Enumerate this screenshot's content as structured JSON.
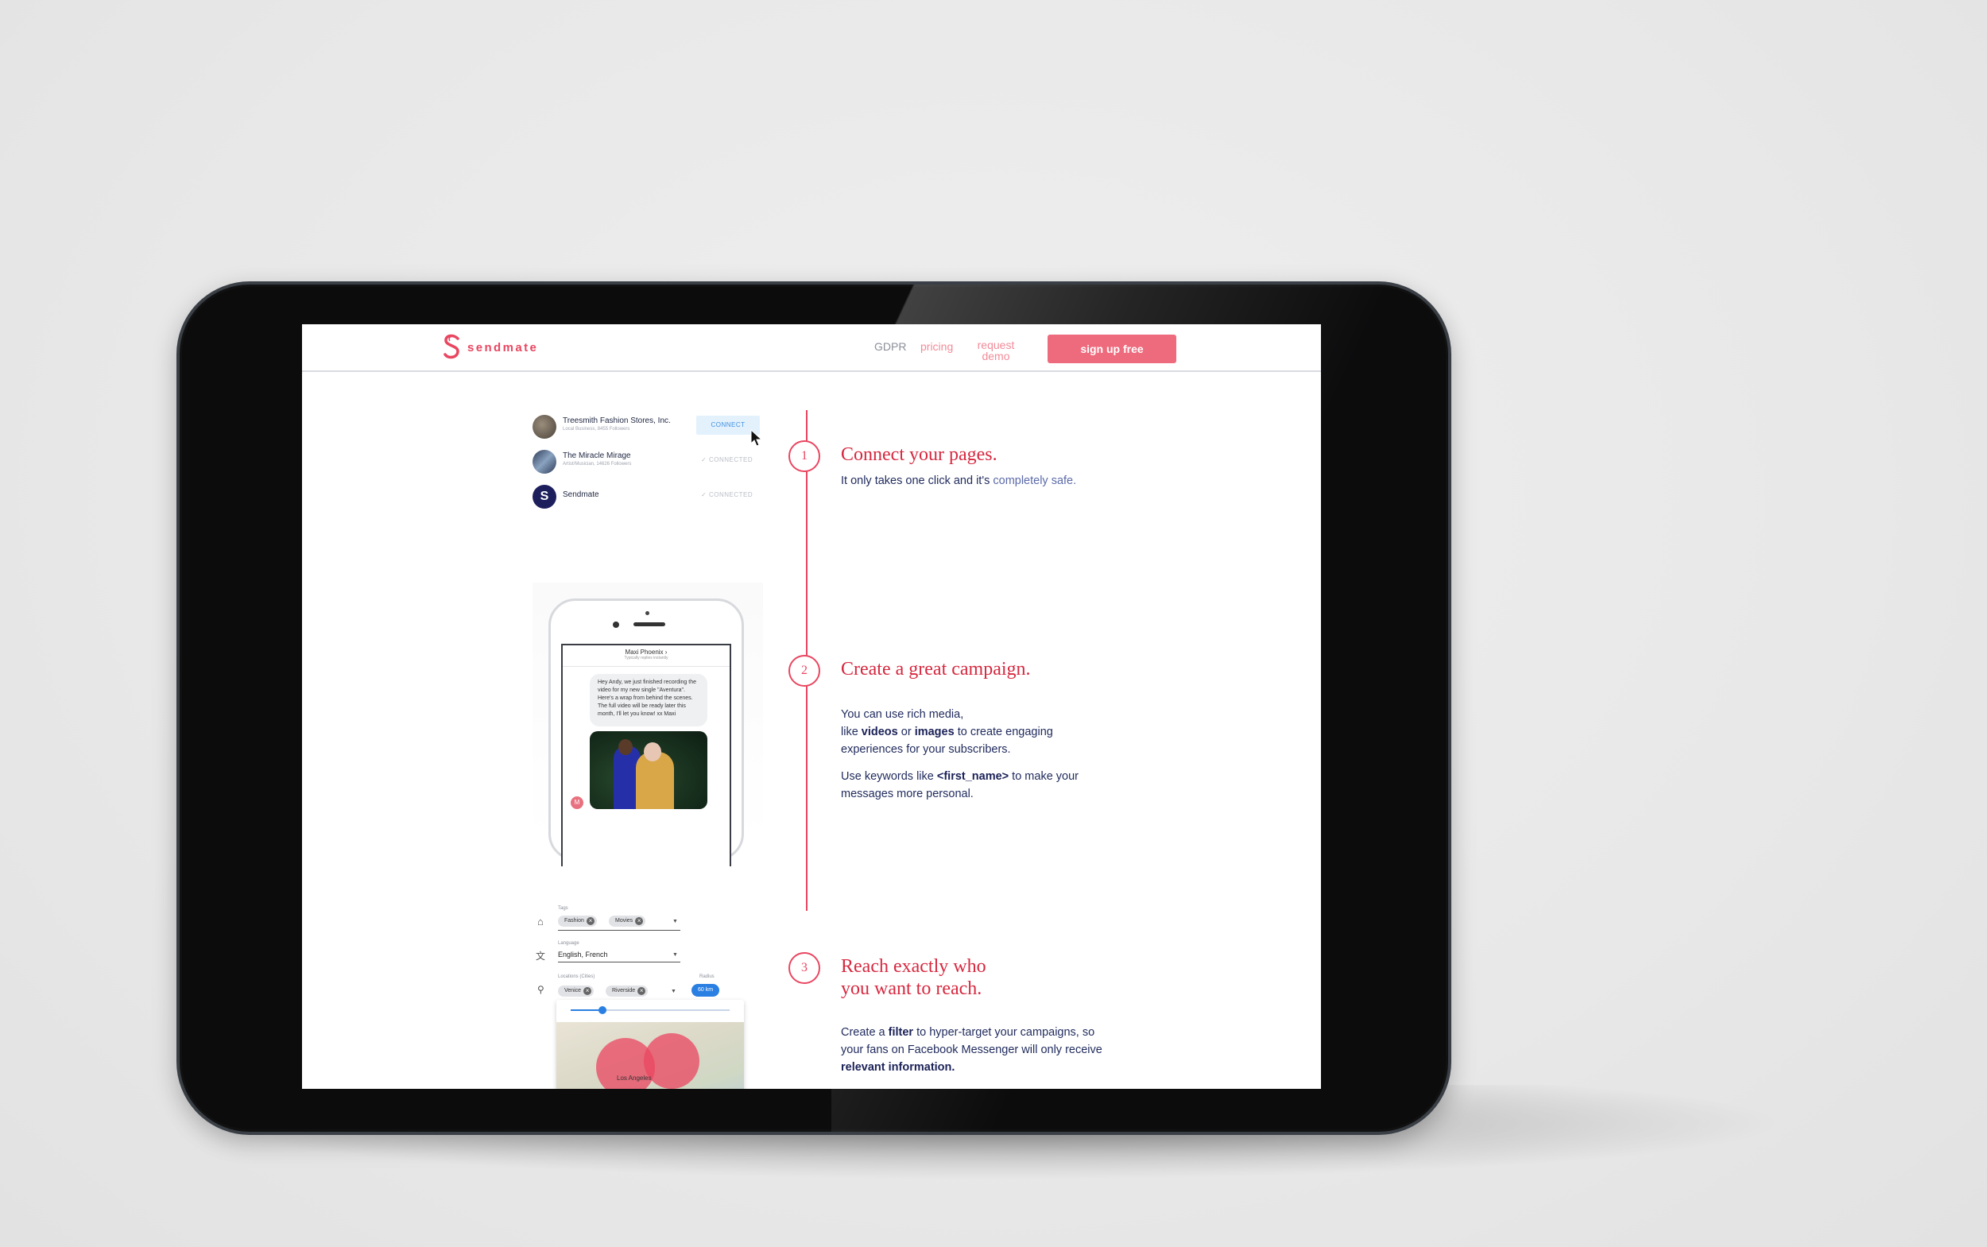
{
  "nav": {
    "brand": "sendmate",
    "links": {
      "gdpr": "GDPR",
      "pricing": "pricing",
      "demo": "request demo"
    },
    "signup": "sign up free"
  },
  "pages_list": [
    {
      "name": "Treesmith Fashion Stores, Inc.",
      "sub": "Local Business, 8455 Followers",
      "action": "CONNECT"
    },
    {
      "name": "The Miracle Mirage",
      "sub": "Artist/Musician, 14626 Followers",
      "action": "CONNECTED"
    },
    {
      "name": "Sendmate",
      "sub": "",
      "action": "CONNECTED"
    }
  ],
  "phone": {
    "chat_name": "Maxi Phoenix ›",
    "chat_sub": "Typically replies instantly",
    "bubble": "Hey Andy, we just finished recording the video for my new single \"Aventura\". Here's a wrap from behind the scenes. The full video will be ready later this month, I'll let you know! xx Maxi",
    "avatar_letter": "M"
  },
  "filters": {
    "tags_label": "Tags",
    "tags": [
      "Fashion",
      "Movies"
    ],
    "language_label": "Language",
    "language_value": "English, French",
    "locations_label": "Locations (Cities)",
    "locations": [
      "Venice",
      "Riverside"
    ],
    "radius_label": "Radius",
    "radius_value": "60 km",
    "map_place": "Los Angeles"
  },
  "steps": [
    {
      "num": "1",
      "title": "Connect your pages.",
      "text_a": "It only takes one click and it's ",
      "text_b": "completely safe."
    },
    {
      "num": "2",
      "title": "Create a great campaign.",
      "p1_a": "You can use rich media,",
      "p1_b": "like ",
      "p1_videos": "videos",
      "p1_or": " or ",
      "p1_images": "images",
      "p1_c": " to create engaging experiences for your subscribers.",
      "p2_a": "Use keywords like ",
      "p2_kw": "<first_name>",
      "p2_b": " to make your messages more personal."
    },
    {
      "num": "3",
      "title_l1": "Reach exactly who",
      "title_l2": "you want to reach.",
      "p_a": "Create a ",
      "p_filter": "filter",
      "p_b": " to hyper-target your campaigns, so your fans on Facebook Messenger will only receive ",
      "p_rel": "relevant information."
    }
  ],
  "colors": {
    "brand": "#e94660",
    "signup_bg": "#ee6b7d",
    "text_navy": "#1f2a5c",
    "radius_blue": "#2a7fe2"
  }
}
